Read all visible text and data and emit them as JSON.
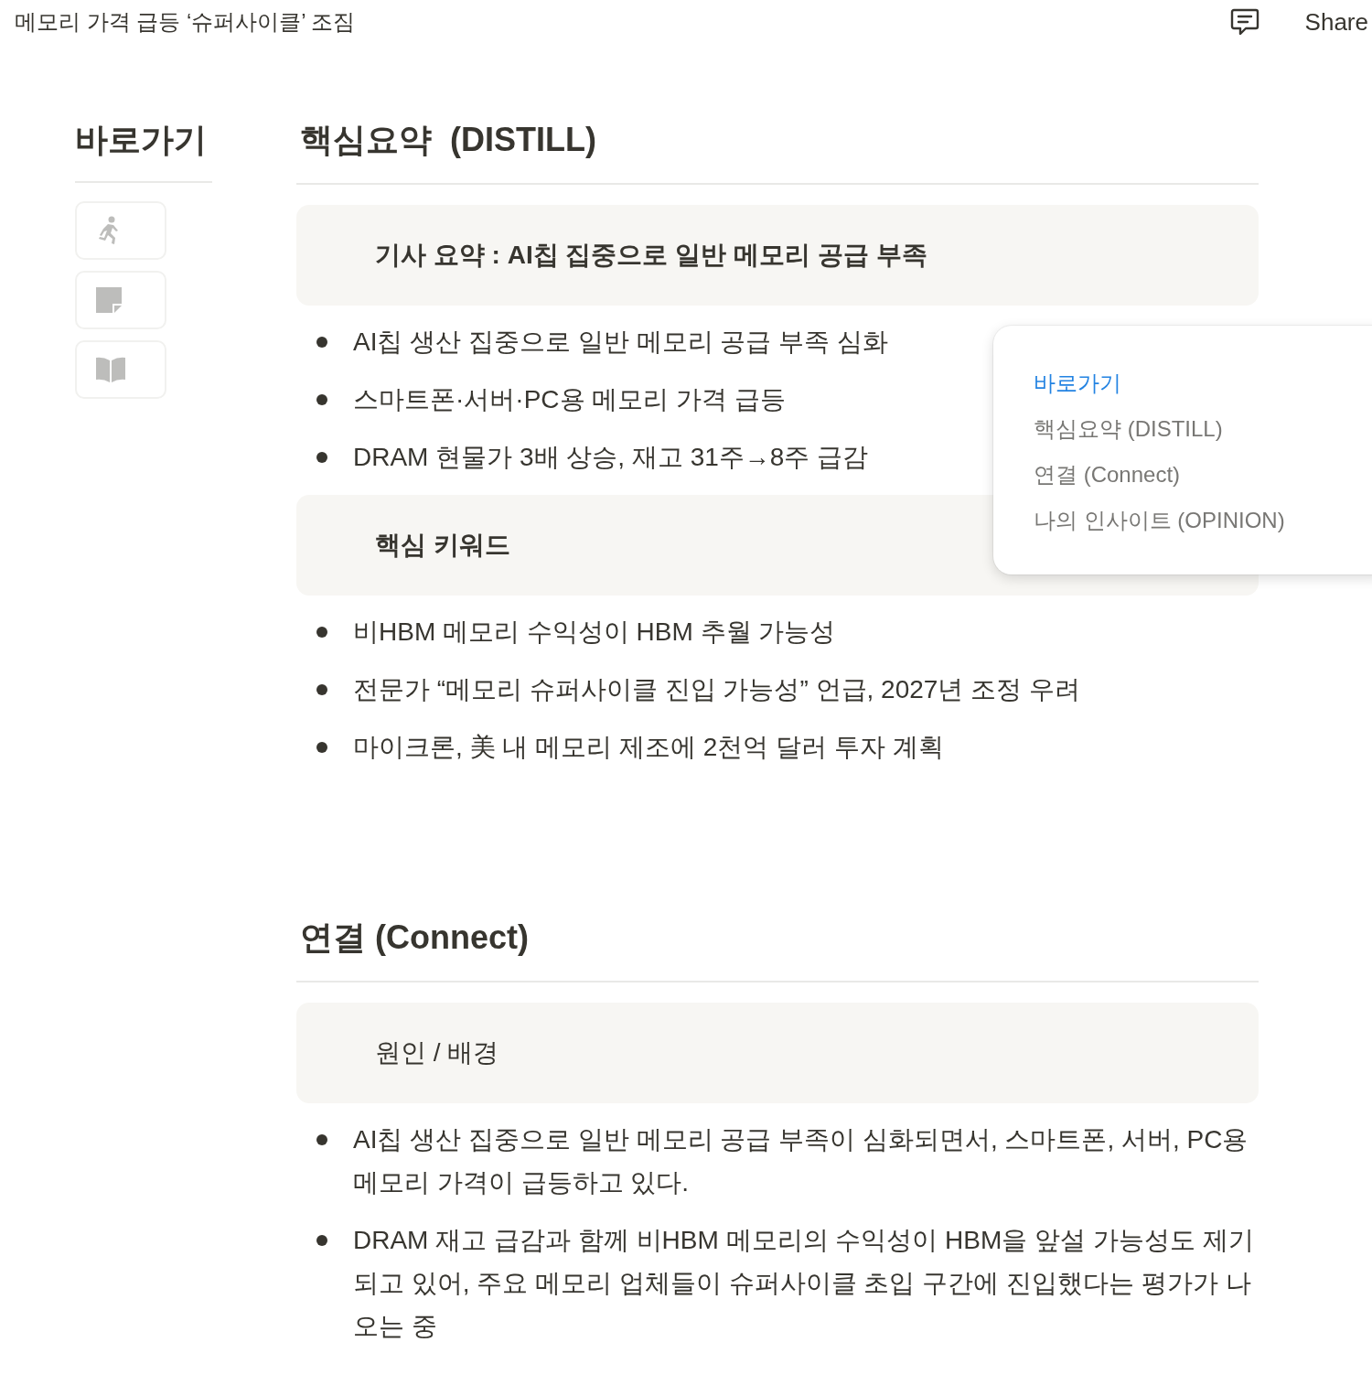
{
  "topbar": {
    "title": "메모리 가격 급등 ‘슈퍼사이클’ 조짐",
    "share": "Share"
  },
  "sidebar": {
    "title": "바로가기",
    "tiles": [
      {
        "kind": "runner"
      },
      {
        "kind": "note"
      },
      {
        "kind": "book"
      }
    ]
  },
  "sections": [
    {
      "heading": "핵심요약  (DISTILL)",
      "blocks": [
        {
          "kind": "callout",
          "text": "기사 요약 : AI칩 집중으로 일반 메모리 공급 부족",
          "bold": true
        },
        {
          "kind": "bullets",
          "items": [
            "AI칩 생산 집중으로 일반 메모리 공급 부족 심화",
            "스마트폰·서버·PC용 메모리 가격 급등",
            "DRAM 현물가 3배 상승, 재고 31주→8주 급감"
          ]
        },
        {
          "kind": "callout",
          "text": "핵심 키워드",
          "bold": true
        },
        {
          "kind": "bullets",
          "items": [
            "비HBM 메모리 수익성이 HBM 추월 가능성",
            "전문가 “메모리 슈퍼사이클 진입 가능성” 언급, 2027년 조정 우려",
            "마이크론, 美 내 메모리 제조에 2천억 달러 투자 계획"
          ]
        }
      ]
    },
    {
      "heading": "연결 (Connect)",
      "blocks": [
        {
          "kind": "callout",
          "text": "원인 / 배경",
          "bold": false
        },
        {
          "kind": "bullets",
          "items": [
            "AI칩 생산 집중으로 일반 메모리 공급 부족이 심화되면서, 스마트폰, 서버, PC용 메모리 가격이 급등하고 있다.",
            "DRAM 재고 급감과 함께 비HBM 메모리의 수익성이 HBM을 앞설 가능성도 제기되고 있어, 주요 메모리 업체들이 슈퍼사이클 초입 구간에 진입했다는 평가가 나오는 중"
          ]
        }
      ]
    }
  ],
  "toc_popup": {
    "items": [
      {
        "label": "바로가기",
        "selected": true
      },
      {
        "label": "핵심요약 (DISTILL)",
        "selected": false
      },
      {
        "label": "연결 (Connect)",
        "selected": false
      },
      {
        "label": "나의 인사이트 (OPINION)",
        "selected": false
      }
    ]
  }
}
